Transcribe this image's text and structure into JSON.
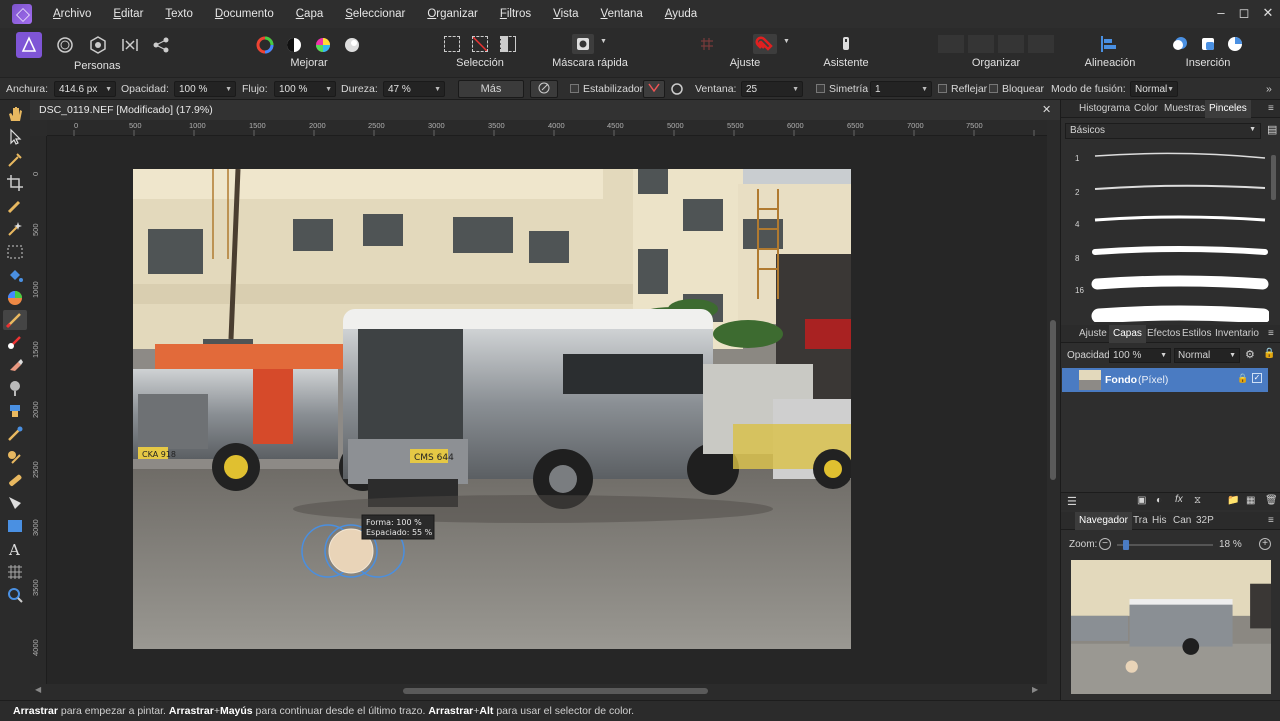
{
  "menu": [
    "Archivo",
    "Editar",
    "Texto",
    "Documento",
    "Capa",
    "Seleccionar",
    "Organizar",
    "Filtros",
    "Vista",
    "Ventana",
    "Ayuda"
  ],
  "toolbar": {
    "personas": "Personas",
    "mejorar": "Mejorar",
    "seleccion": "Selección",
    "mascara": "Máscara rápida",
    "ajuste": "Ajuste",
    "asistente": "Asistente",
    "organizar": "Organizar",
    "alineacion": "Alineación",
    "insercion": "Inserción"
  },
  "context": {
    "anchura_label": "Anchura:",
    "anchura_value": "414.6 px",
    "opacidad_label": "Opacidad:",
    "opacidad_value": "100 %",
    "flujo_label": "Flujo:",
    "flujo_value": "100 %",
    "dureza_label": "Dureza:",
    "dureza_value": "47 %",
    "mas_button": "Más",
    "estabilizador": "Estabilizador",
    "ventana_label": "Ventana:",
    "ventana_value": "25",
    "simetria": "Simetría",
    "simetria_value": "1",
    "reflejar": "Reflejar",
    "bloquear": "Bloquear",
    "fusion_label": "Modo de fusión:",
    "fusion_value": "Normal"
  },
  "document": {
    "tab_title": "DSC_0119.NEF [Modificado] (17.9%)",
    "ruler_top": [
      "0",
      "500",
      "1000",
      "1500",
      "2000",
      "2500",
      "3000",
      "3500",
      "4000",
      "4500",
      "5000",
      "5500",
      "6000",
      "6500",
      "7000",
      "7500"
    ],
    "ruler_left": [
      "0",
      "500",
      "1000",
      "1500",
      "2000",
      "2500",
      "3000",
      "3500",
      "4000"
    ],
    "plates": [
      "CKA 918",
      "CMS 644"
    ],
    "brush_tooltip": {
      "forma": "Forma: 100 %",
      "espaciado": "Espaciado: 55 %"
    }
  },
  "panels": {
    "top_tabs": [
      "Histograma",
      "Color",
      "Muestras",
      "Pinceles"
    ],
    "brush_category": "Básicos",
    "brush_sizes": [
      "1",
      "2",
      "4",
      "8",
      "16",
      ""
    ],
    "mid_tabs": [
      "Ajuste",
      "Capas",
      "Efectos",
      "Estilos",
      "Inventario"
    ],
    "layers": {
      "opacidad_label": "Opacidad:",
      "opacidad_value": "100 %",
      "blend_value": "Normal",
      "layer_name": "Fondo",
      "layer_type": "(Píxel)"
    },
    "nav_tabs": [
      "Navegador",
      "Tra",
      "His",
      "Can",
      "32P"
    ],
    "zoom_label": "Zoom:",
    "zoom_value": "18 %"
  },
  "status": {
    "p1": "Arrastrar",
    "t1": " para empezar a pintar. ",
    "p2": "Arrastrar",
    "t2": "+",
    "p3": "Mayús",
    "t3": " para continuar desde el último trazo. ",
    "p4": "Arrastrar",
    "t4": "+",
    "p5": "Alt",
    "t5": " para usar el selector de color."
  },
  "colors": {
    "accent": "#4a7bc2",
    "layer_highlight": "#4a7bc2"
  }
}
